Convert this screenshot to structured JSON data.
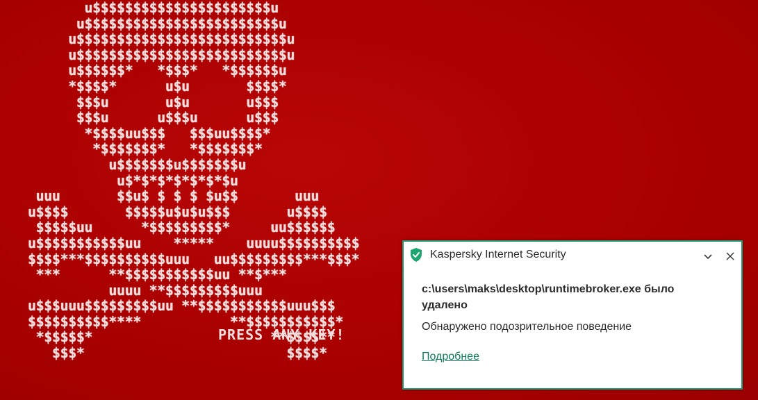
{
  "background": {
    "ascii_art": "       u$$$$$$$$$$$$$$$$$$$$$$u\n      u$$$$$$$$$$$$$$$$$$$$$$$$u\n     u$$$$$$$$$$$$$$$$$$$$$$$$$$u\n     u$$$$$$$$$$$$$$$$$$$$$$$$$$u\n     u$$$$$$*   *$$$*   *$$$$$$u\n     *$$$$*      u$u       $$$$*\n      $$$u       u$u       u$$$\n      $$$u      u$$$u      u$$$\n       *$$$$uu$$$   $$$uu$$$$*\n        *$$$$$$$*   *$$$$$$$*\n          u$$$$$$$u$$$$$$$u\n           u$*$*$*$*$*$*$u\n uuu       $$u$ $ $ $ $u$$       uuu\nu$$$$       $$$$$u$u$u$$$       u$$$$\n $$$$$uu      *$$$$$$$$$*     uu$$$$$$\nu$$$$$$$$$$$uu    *****    uuuu$$$$$$$$$$\n$$$$***$$$$$$$$$$uuu   uu$$$$$$$$$***$$$*\n ***      **$$$$$$$$$$$uu **$***\n          uuuu **$$$$$$$$$uuu\nu$$$uuu$$$$$$$$$uu **$$$$$$$$$$$uuu$$$\n$$$$$$$$$$****           **$$$$$$$$$$$*\n *$$$$$*                      **$$$$**\n   $$$*                         $$$$*",
    "press_key": "PRESS ANY KEY!"
  },
  "notification": {
    "title": "Kaspersky Internet Security",
    "path_line": "c:\\users\\maks\\desktop\\runtimebroker.exe было удалено",
    "message": "Обнаружено подозрительное поведение",
    "link": "Подробнее",
    "colors": {
      "accent": "#1a9a6e",
      "link": "#0a7d5a",
      "shield": "#1ea672"
    },
    "icons": {
      "shield": "kaspersky-shield-icon",
      "expand": "chevron-down-icon",
      "close": "close-icon"
    }
  }
}
